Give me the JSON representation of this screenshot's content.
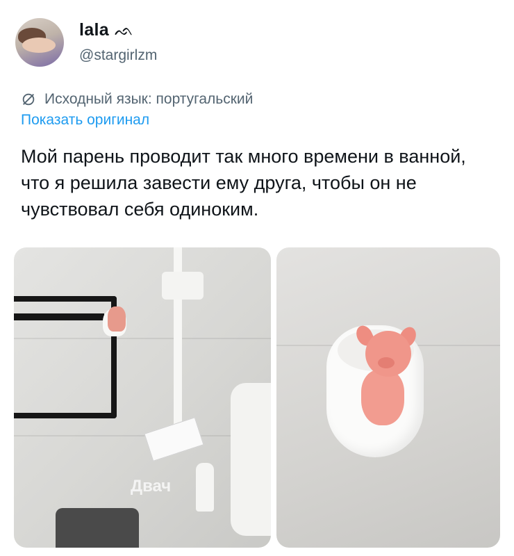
{
  "author": {
    "display_name": "lala",
    "name_glyph": "ᨒ",
    "handle": "@stargirlzm"
  },
  "translation": {
    "notice": "Исходный язык: португальский",
    "show_original": "Показать оригинал"
  },
  "tweet": {
    "text": "Мой парень проводит так много времени в ванной, что я решила завести ему друга, чтобы он не чувствовал себя одиноким."
  },
  "media": {
    "watermark": "Двач"
  },
  "colors": {
    "link": "#1d9bf0",
    "secondary_text": "#536471",
    "primary_text": "#0f1419"
  },
  "icons": {
    "translate": "globe-slash-icon"
  }
}
